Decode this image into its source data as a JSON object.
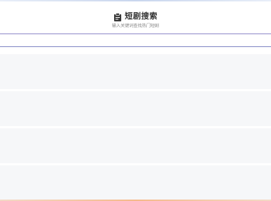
{
  "header": {
    "title": "短剧搜索",
    "subtitle": "输入关键词查找热门短剧"
  },
  "search": {
    "value": "",
    "placeholder": ""
  },
  "results": [
    {
      "title": ""
    },
    {
      "title": ""
    },
    {
      "title": ""
    },
    {
      "title": ""
    }
  ]
}
